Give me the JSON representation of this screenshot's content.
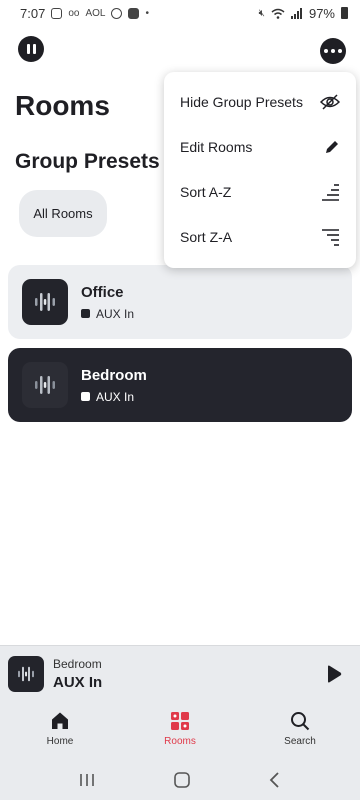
{
  "status_bar": {
    "time": "7:07",
    "battery": "97%"
  },
  "header": {
    "title": "Rooms",
    "pause_icon": "pause-icon",
    "more_icon": "more-horizontal-icon"
  },
  "group_presets": {
    "title": "Group Presets",
    "chips": [
      "All Rooms"
    ]
  },
  "rooms": [
    {
      "name": "Office",
      "source": "AUX In",
      "selected": false
    },
    {
      "name": "Bedroom",
      "source": "AUX In",
      "selected": true
    }
  ],
  "menu": {
    "items": [
      {
        "label": "Hide Group Presets",
        "icon": "eye-off-icon"
      },
      {
        "label": "Edit Rooms",
        "icon": "pencil-icon"
      },
      {
        "label": "Sort A-Z",
        "icon": "sort-ascending-icon"
      },
      {
        "label": "Sort Z-A",
        "icon": "sort-descending-icon"
      }
    ]
  },
  "now_playing": {
    "room": "Bedroom",
    "source": "AUX In",
    "play_icon": "play-icon"
  },
  "bottom_nav": {
    "items": [
      {
        "label": "Home",
        "icon": "home-icon",
        "active": false
      },
      {
        "label": "Rooms",
        "icon": "rooms-grid-icon",
        "active": true
      },
      {
        "label": "Search",
        "icon": "search-icon",
        "active": false
      }
    ]
  },
  "colors": {
    "accent": "#e03a4a",
    "dark": "#1f1f24",
    "surface": "#e9ebee"
  }
}
